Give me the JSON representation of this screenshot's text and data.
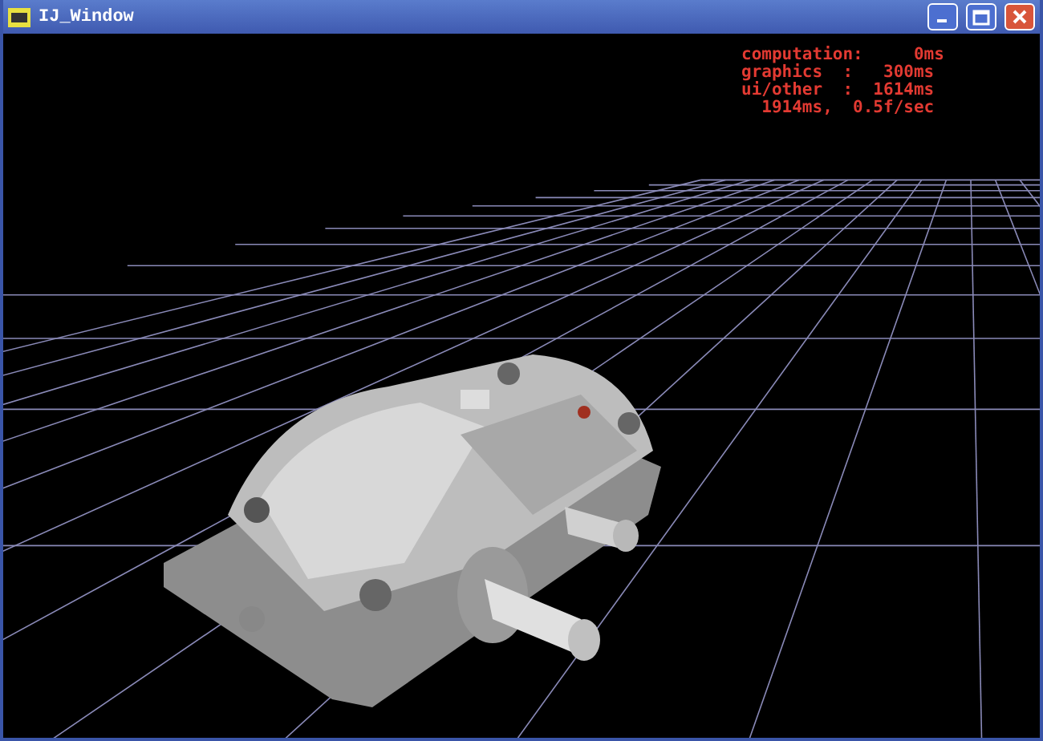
{
  "window": {
    "title": "IJ_Window"
  },
  "stats": [
    "computation:     0ms",
    "graphics  :   300ms",
    "ui/other  :  1614ms",
    "  1914ms,  0.5f/sec"
  ]
}
